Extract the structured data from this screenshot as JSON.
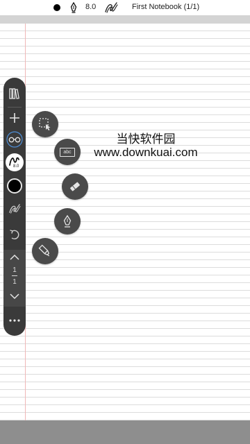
{
  "status_bar": {
    "brush_size": "8.0",
    "notebook_title": "First Notebook (1/1)"
  },
  "toolbar": {
    "items": [
      "library-icon",
      "add-icon",
      "glasses-icon",
      "pen-preset-icon",
      "color-icon",
      "stroke-icon",
      "undo-icon",
      "page-up-icon",
      "page-down-icon",
      "more-icon"
    ],
    "pen_preset_size": "8.0",
    "current_page": "1",
    "total_pages": "1",
    "more_label": "..."
  },
  "tool_fan": {
    "items": [
      "lasso-select-icon",
      "text-box-icon",
      "eraser-icon",
      "fountain-pen-icon",
      "highlighter-icon"
    ],
    "text_box_label": "abc"
  },
  "watermark": {
    "title": "当快软件园",
    "url": "www.downkuai.com"
  },
  "colors": {
    "toolbar_bg": "#3a3a3a",
    "fab_bg": "#4a4a4a",
    "glasses_accent": "#4f8fd8",
    "margin_line": "#f0b8b8",
    "ruled_line": "#dcdcdc",
    "bottom_bar": "#8e8e8e"
  }
}
